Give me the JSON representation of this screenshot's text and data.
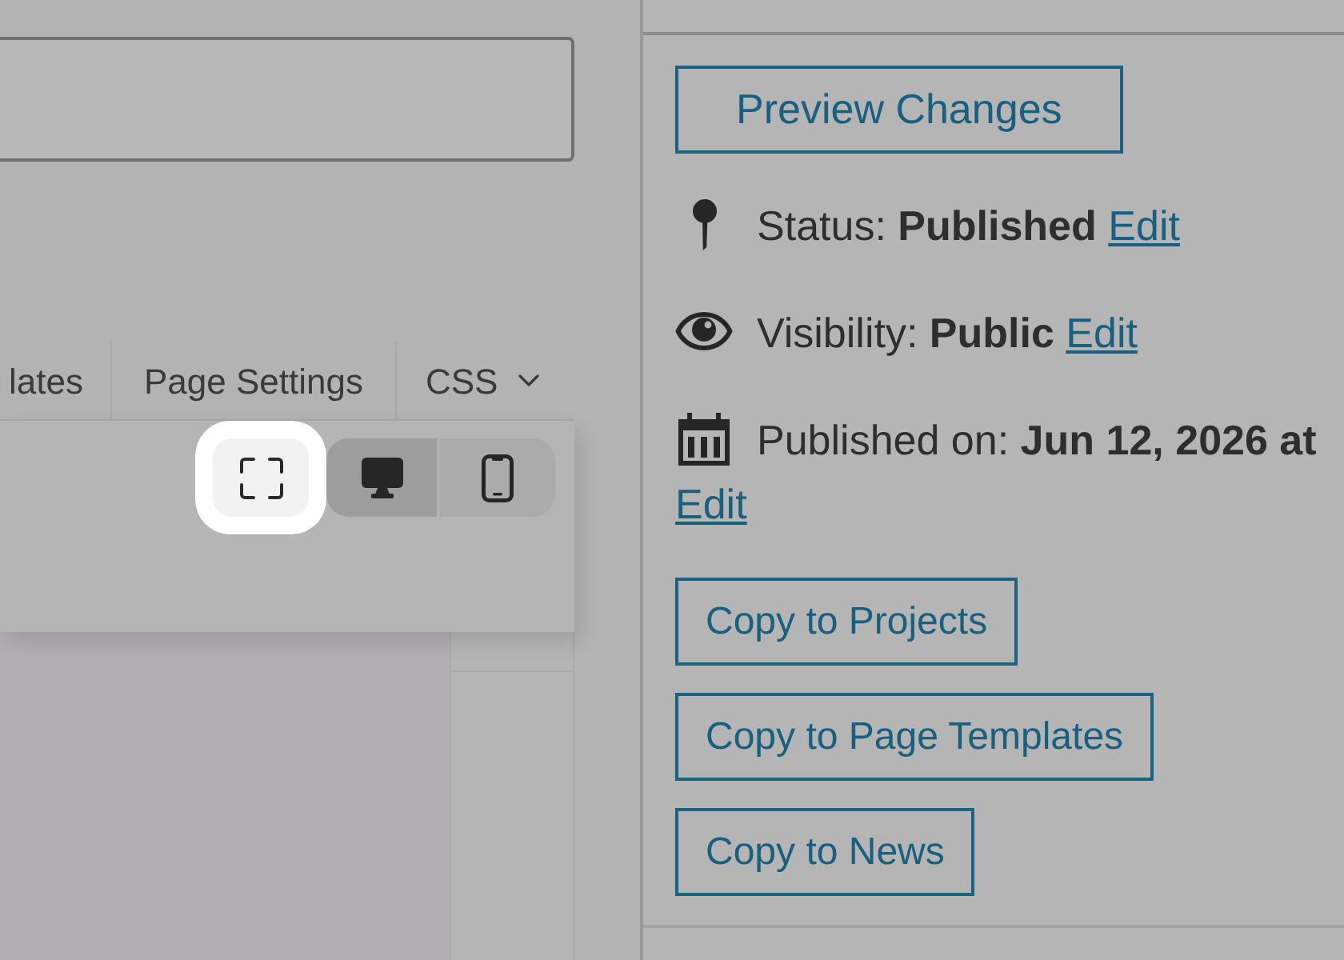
{
  "editor": {
    "tabs": [
      {
        "kind": "tab",
        "label": "lates",
        "selected": false
      },
      {
        "kind": "tab",
        "label": "Page Settings",
        "selected": false
      },
      {
        "kind": "menu",
        "label": "CSS",
        "selected": false
      }
    ],
    "preview_toolbar": {
      "fullscreen_button": {
        "highlighted": true
      },
      "devices": [
        {
          "kind": "desktop",
          "selected": true
        },
        {
          "kind": "mobile",
          "selected": false
        }
      ]
    }
  },
  "publish_box": {
    "preview_button": "Preview Changes",
    "meta": [
      {
        "kind": "status",
        "text": "Status: **Published**",
        "link": "Edit"
      },
      {
        "kind": "visibility",
        "text": "Visibility: **Public**",
        "link": "Edit"
      },
      {
        "kind": "schedule",
        "text": "Published on: **Jun 12, 2026 at**",
        "link": "Edit"
      }
    ],
    "copy_buttons": [
      "Copy to Projects",
      "Copy to Page Templates",
      "Copy to News"
    ]
  }
}
